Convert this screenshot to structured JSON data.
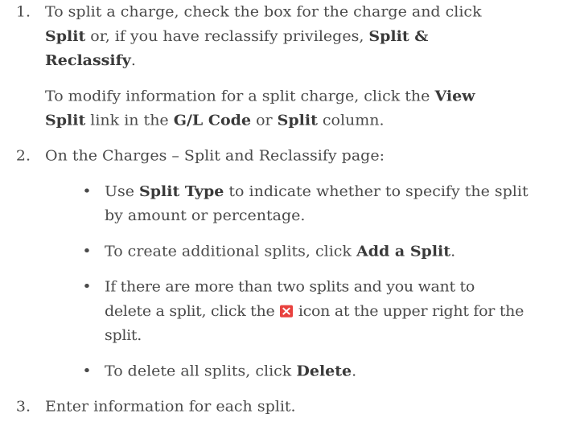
{
  "steps": [
    {
      "number": "1.",
      "lines": [
        [
          "To split a charge, check the box for the charge and click "
        ],
        [
          "Split",
          " or, if you have reclassify privileges, ",
          "Split &"
        ],
        [
          "Reclassify",
          "."
        ]
      ],
      "followup": [
        [
          "To modify information for a split charge, click the ",
          "View"
        ],
        [
          "Split",
          " link in the ",
          "G/L Code",
          " or ",
          "Split",
          " column."
        ]
      ]
    },
    {
      "number": "2.",
      "text": "On the Charges – Split and Reclassify page:",
      "bullets": [
        {
          "parts": [
            "Use ",
            "Split Type",
            " to indicate whether to specify the split"
          ],
          "line2": "by amount or percentage."
        },
        {
          "parts": [
            "To create additional splits, click ",
            "Add a Split",
            "."
          ]
        },
        {
          "line1": "If there are more than two splits and you want to",
          "line2a": "delete a split, click the ",
          "line2b": " icon at the upper right for the",
          "line3": "split.",
          "icon": "delete-icon"
        },
        {
          "parts": [
            "To delete all splits, click ",
            "Delete",
            "."
          ]
        }
      ]
    },
    {
      "number": "3.",
      "text": "Enter information for each split."
    }
  ],
  "bullet_glyph": "•"
}
